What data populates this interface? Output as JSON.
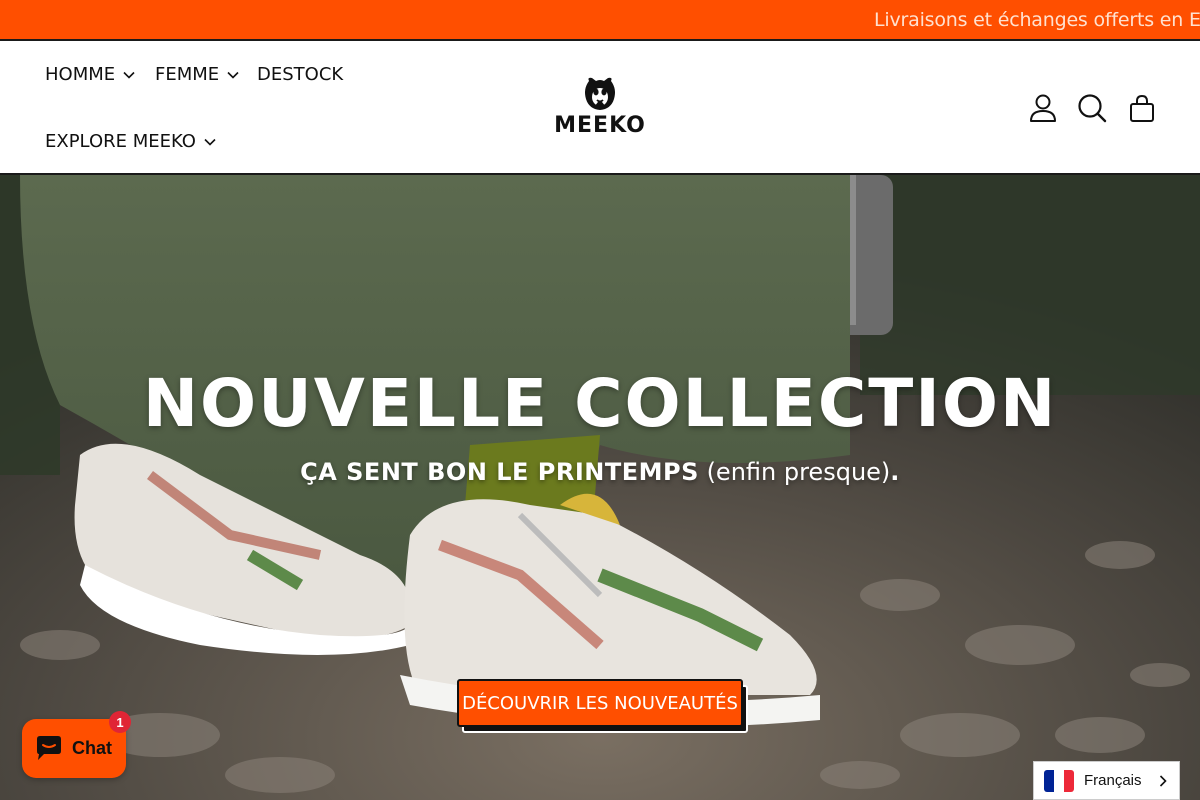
{
  "announcement": {
    "text": "Livraisons et échanges offerts en Eur"
  },
  "nav": {
    "items": [
      {
        "label": "HOMME",
        "has_dropdown": true
      },
      {
        "label": "FEMME",
        "has_dropdown": true
      },
      {
        "label": "DESTOCK",
        "has_dropdown": false
      },
      {
        "label": "EXPLORE MEEKO",
        "has_dropdown": true
      }
    ]
  },
  "logo": {
    "text": "MEEKO"
  },
  "header_icons": [
    "account-icon",
    "search-icon",
    "cart-icon"
  ],
  "hero": {
    "title": "NOUVELLE COLLECTION",
    "subtitle_bold": "ÇA SENT BON LE PRINTEMPS",
    "subtitle_light": "(enfin presque)",
    "subtitle_end": ".",
    "cta_label": "DÉCOUVRIR LES NOUVEAUTÉS"
  },
  "chat": {
    "label": "Chat",
    "badge_count": "1"
  },
  "language": {
    "label": "Français"
  },
  "colors": {
    "accent": "#ff4f00",
    "text": "#111111",
    "badge": "#e02535",
    "flag_blue": "#002395",
    "flag_white": "#ffffff",
    "flag_red": "#ed2939"
  }
}
